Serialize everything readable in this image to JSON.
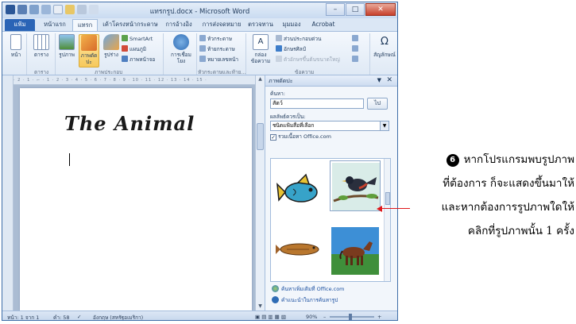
{
  "window": {
    "title": "แทรกรูป.docx - Microsoft Word",
    "minimize": "–",
    "maximize": "□",
    "close": "✕"
  },
  "ribbon_tabs": [
    "แฟ้ม",
    "หน้าแรก",
    "แทรก",
    "เค้าโครงหน้ากระดาษ",
    "การอ้างอิง",
    "การส่งจดหมาย",
    "ตรวจทาน",
    "มุมมอง",
    "Acrobat"
  ],
  "ribbon": {
    "pages": "หน้า",
    "table": "ตาราง",
    "picture": "รูปภาพ",
    "clipart": "ภาพตัดปะ",
    "shapes": "รูปร่าง",
    "smartart": "SmartArt",
    "chart": "แผนภูมิ",
    "screenshot": "ภาพหน้าจอ",
    "hyperlink": "การเชื่อมโยง",
    "header": "หัวกระดาษ",
    "footer": "ท้ายกระดาษ",
    "page_number": "หมายเลขหน้า",
    "textbox": "กล่องข้อความ",
    "quickparts": "ส่วนประกอบด่วน",
    "wordart": "อักษรศิลป์",
    "dropcap": "ตัวอักษรขึ้นต้นขนาดใหญ่",
    "symbol": "สัญลักษณ์",
    "group_table": "ตาราง",
    "group_illustrations": "ภาพประกอบ",
    "group_header_footer": "หัวกระดาษและท้าย...",
    "group_text": "ข้อความ"
  },
  "document": {
    "ruler": "· 2 · 1 · ⌐ · 1 · 2 · 3 · 4 · 5 · 6 · 7 · 8 · 9 · 10 · 11 · 12 · 13 · 14 · 15 ·",
    "heading": "The Animal"
  },
  "clipart_pane": {
    "title": "ภาพตัดปะ",
    "search_label": "ค้นหา:",
    "search_value": "สัตว์",
    "go_button": "ไป",
    "results_label": "ผลลัพธ์ควรเป็น:",
    "media_type": "ชนิดแฟ้มสื่อที่เลือก",
    "include_office": "รวมเนื้อหา Office.com",
    "link_more": "ค้นหาเพิ่มเติมที่ Office.com",
    "link_tips": "คำแนะนำในการค้นหารูป",
    "results": [
      "fish-blue",
      "bird-on-branch",
      "fish-brown",
      "horse"
    ]
  },
  "status_bar": {
    "page": "หน้า: 1 จาก 1",
    "words": "คำ: 58",
    "language": "อังกฤษ (สหรัฐอเมริกา)",
    "zoom": "90%"
  },
  "annotation": {
    "number": "6",
    "lines": [
      "หากโปรแกรมพบรูปภาพ",
      "ที่ต้องการ ก็จะแสดงขึ้นมาให้",
      "และหากต้องการรูปภาพใดให้",
      "คลิกที่รูปภาพนั้น 1 ครั้ง"
    ]
  },
  "colors": {
    "arrow": "#e0181b",
    "file_tab": "#2a64b6",
    "link": "#1a4fa0"
  }
}
